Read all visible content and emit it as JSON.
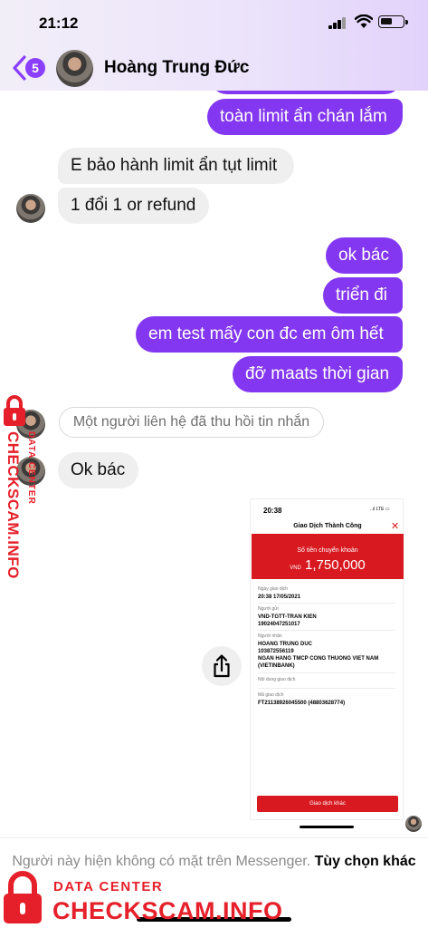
{
  "status_bar": {
    "time": "21:12"
  },
  "header": {
    "back_badge": "5",
    "contact_name": "Hoàng Trung Đức"
  },
  "messages": {
    "m1": "toàn limit ẩn chán lắm",
    "m2": "E bảo hành limit ẩn tụt limit",
    "m3": "1 đổi 1 or refund",
    "m4": "ok bác",
    "m5": "triển đi",
    "m6": "em test mấy con đc em ôm hết",
    "m7": "đỡ maats thời gian",
    "unsent": "Một người liên hệ đã thu hồi tin nhắn",
    "m8": "Ok bác"
  },
  "receipt": {
    "time": "20:38",
    "status": "..ıl LTE ▭",
    "title": "Giao Dịch Thành Công",
    "transfer_label": "Số tiền chuyển khoản",
    "currency": "VND",
    "amount": "1,750,000",
    "date_label": "Ngày giao dịch",
    "date_value": "20:38 17/05/2021",
    "sender_label": "Người gửi",
    "sender_line1": "VND-TGTT-TRAN KIEN",
    "sender_line2": "19024047251017",
    "recipient_label": "Người nhận",
    "recipient_line1": "HOANG TRUNG DUC",
    "recipient_line2": "103872556119",
    "recipient_line3": "NGAN HANG TMCP CONG THUONG VIET NAM",
    "recipient_line4": "(VIETINBANK)",
    "content_label": "Nội dung giao dịch",
    "code_label": "Mã giao dịch",
    "code_value": "FT21138926045500 (48803628774)",
    "button": "Giao dịch khác"
  },
  "footer": {
    "text": "Người này hiện không có mặt trên Messenger.",
    "link": "Tùy chọn khác"
  },
  "watermark": {
    "data_center": "DATA CENTER",
    "brand": "CHECKSCAM.INFO"
  },
  "colors": {
    "accent": "#8a3ffc",
    "outgoing_bubble": "#8337f0",
    "incoming_bubble": "#efefef",
    "bank_red": "#d81920",
    "watermark_red": "#e6202a"
  },
  "icons": [
    "chevron-left-icon",
    "cellular-signal-icon",
    "wifi-icon",
    "battery-icon",
    "share-icon",
    "close-icon",
    "padlock-icon"
  ]
}
